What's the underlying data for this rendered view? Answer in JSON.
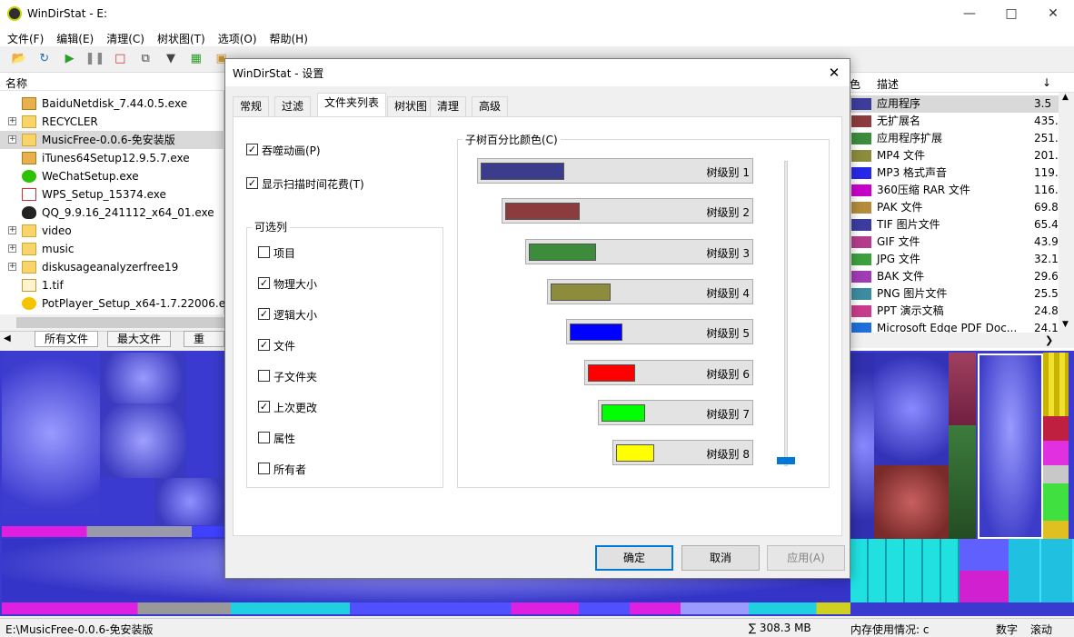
{
  "app": {
    "title": "WinDirStat - E:"
  },
  "menu": [
    "文件(F)",
    "编辑(E)",
    "清理(C)",
    "树状图(T)",
    "选项(O)",
    "帮助(H)"
  ],
  "tree": {
    "header": "名称",
    "items": [
      {
        "label": "BaiduNetdisk_7.44.0.5.exe",
        "expandable": false,
        "icon": "installer-icon",
        "selected": false
      },
      {
        "label": "RECYCLER",
        "expandable": true,
        "icon": "folder-icon",
        "selected": false
      },
      {
        "label": "MusicFree-0.0.6-免安装版",
        "expandable": true,
        "icon": "folder-icon",
        "selected": true
      },
      {
        "label": "iTunes64Setup12.9.5.7.exe",
        "expandable": false,
        "icon": "installer-icon",
        "selected": false
      },
      {
        "label": "WeChatSetup.exe",
        "expandable": false,
        "icon": "wechat-icon",
        "selected": false
      },
      {
        "label": "WPS_Setup_15374.exe",
        "expandable": false,
        "icon": "wps-icon",
        "selected": false
      },
      {
        "label": "QQ_9.9.16_241112_x64_01.exe",
        "expandable": false,
        "icon": "qq-icon",
        "selected": false
      },
      {
        "label": "video",
        "expandable": true,
        "icon": "folder-icon",
        "selected": false
      },
      {
        "label": "music",
        "expandable": true,
        "icon": "folder-icon",
        "selected": false
      },
      {
        "label": "diskusageanalyzerfree19",
        "expandable": true,
        "icon": "folder-icon",
        "selected": false
      },
      {
        "label": "1.tif",
        "expandable": false,
        "icon": "tif-icon",
        "selected": false
      },
      {
        "label": "PotPlayer_Setup_x64-1.7.22006.e...",
        "expandable": false,
        "icon": "potplayer-icon",
        "selected": false
      }
    ]
  },
  "bottom_tabs": [
    "所有文件",
    "最大文件",
    "重复文"
  ],
  "extlist": {
    "col_color": "色",
    "col_desc": "描述",
    "col_sort": "↓",
    "items": [
      {
        "color": "#3c3c9c",
        "desc": "应用程序",
        "value": "3.5",
        "selected": true
      },
      {
        "color": "#8c3c3c",
        "desc": "无扩展名",
        "value": "435."
      },
      {
        "color": "#3c8c3c",
        "desc": "应用程序扩展",
        "value": "251."
      },
      {
        "color": "#8c8c3c",
        "desc": "MP4 文件",
        "value": "201."
      },
      {
        "color": "#2828e8",
        "desc": "MP3 格式声音",
        "value": "119."
      },
      {
        "color": "#c800c8",
        "desc": "360压缩 RAR 文件",
        "value": "116."
      },
      {
        "color": "#b48c3c",
        "desc": "PAK 文件",
        "value": "69.8"
      },
      {
        "color": "#3c3ca0",
        "desc": "TIF 图片文件",
        "value": "65.4"
      },
      {
        "color": "#b43c8c",
        "desc": "GIF 文件",
        "value": "43.9"
      },
      {
        "color": "#3ca03c",
        "desc": "JPG 文件",
        "value": "32.1"
      },
      {
        "color": "#a03cb4",
        "desc": "BAK 文件",
        "value": "29.6"
      },
      {
        "color": "#3c8ca0",
        "desc": "PNG 图片文件",
        "value": "25.5"
      },
      {
        "color": "#c83c8c",
        "desc": "PPT 演示文稿",
        "value": "24.8"
      },
      {
        "color": "#1e6edc",
        "desc": "Microsoft Edge PDF Doc...",
        "value": "24.1"
      }
    ]
  },
  "status": {
    "path": "E:\\MusicFree-0.0.6-免安装版",
    "size": "∑ 308.3 MB",
    "memory": "内存使用情况: c",
    "num": "数字",
    "scroll": "滚动"
  },
  "dialog": {
    "title": "WinDirStat - 设置",
    "tabs": [
      "常规",
      "过滤",
      "文件夹列表",
      "树状图",
      "清理",
      "高级"
    ],
    "active_tab": 2,
    "options": [
      {
        "label": "吞噬动画(P)",
        "checked": true
      },
      {
        "label": "显示扫描时间花费(T)",
        "checked": true
      }
    ],
    "columns_group": {
      "title": "可选列",
      "items": [
        {
          "label": "项目",
          "checked": false
        },
        {
          "label": "物理大小",
          "checked": true
        },
        {
          "label": "逻辑大小",
          "checked": true
        },
        {
          "label": "文件",
          "checked": true
        },
        {
          "label": "子文件夹",
          "checked": false
        },
        {
          "label": "上次更改",
          "checked": true
        },
        {
          "label": "属性",
          "checked": false
        },
        {
          "label": "所有者",
          "checked": false
        }
      ]
    },
    "colors_group": {
      "title": "子树百分比颜色(C)",
      "levels": [
        {
          "label": "树级别 1",
          "color": "#3c3c8c"
        },
        {
          "label": "树级别 2",
          "color": "#8c3c3c"
        },
        {
          "label": "树级别 3",
          "color": "#3c8c3c"
        },
        {
          "label": "树级别 4",
          "color": "#8c8c3c"
        },
        {
          "label": "树级别 5",
          "color": "#0000ff"
        },
        {
          "label": "树级别 6",
          "color": "#ff0000"
        },
        {
          "label": "树级别 7",
          "color": "#00ff00"
        },
        {
          "label": "树级别 8",
          "color": "#ffff00"
        }
      ]
    },
    "buttons": {
      "ok": "确定",
      "cancel": "取消",
      "apply": "应用(A)"
    }
  }
}
